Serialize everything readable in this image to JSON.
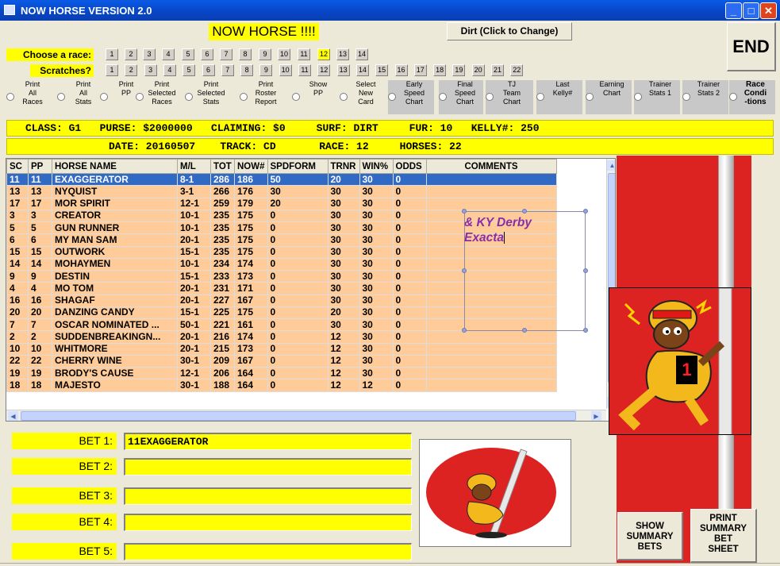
{
  "window": {
    "title": "NOW HORSE VERSION 2.0"
  },
  "header": {
    "app_label": "NOW HORSE !!!!",
    "surface_button": "Dirt (Click to Change)",
    "end_button": "END"
  },
  "race_selector": {
    "label": "Choose  a race:",
    "races": [
      "1",
      "2",
      "3",
      "4",
      "5",
      "6",
      "7",
      "8",
      "9",
      "10",
      "11",
      "12",
      "13",
      "14"
    ],
    "selected": "12"
  },
  "scratches": {
    "label": "Scratches?",
    "numbers": [
      "1",
      "2",
      "3",
      "4",
      "5",
      "6",
      "7",
      "8",
      "9",
      "10",
      "11",
      "12",
      "13",
      "14",
      "15",
      "16",
      "17",
      "18",
      "19",
      "20",
      "21",
      "22"
    ]
  },
  "options": [
    {
      "label": "Print\nAll\nRaces"
    },
    {
      "label": "Print\nAll\nStats"
    },
    {
      "label": "Print\nPP"
    },
    {
      "label": "Print\nSelected\nRaces"
    },
    {
      "label": "Print\nSelected\nStats"
    },
    {
      "label": "Print\nRoster\nReport"
    },
    {
      "label": "Show\nPP"
    },
    {
      "label": "Select\nNew\nCard"
    },
    {
      "label": "Early\nSpeed\nChart"
    },
    {
      "label": "Final\nSpeed\nChart"
    },
    {
      "label": "TJ\nTeam\nChart"
    },
    {
      "label": "Last\nKelly#"
    },
    {
      "label": "Earning\nChart"
    },
    {
      "label": "Trainer\nStats 1"
    },
    {
      "label": "Trainer\nStats 2"
    },
    {
      "label": "Race\nCondi\n-tions"
    }
  ],
  "info": {
    "line1": "CLASS: G1   PURSE: $2000000   CLAIMING: $0     SURF: DIRT     FUR: 10   KELLY#: 250",
    "line2": "DATE: 20160507    TRACK: CD       RACE: 12     HORSES: 22"
  },
  "table": {
    "columns": [
      "SC",
      "PP",
      "HORSE NAME",
      "M/L",
      "TOT",
      "NOW#",
      "SPDFORM",
      "TRNR",
      "WIN%",
      "ODDS",
      "COMMENTS"
    ],
    "rows": [
      [
        "11",
        "11",
        "EXAGGERATOR",
        "8-1",
        "286",
        "186",
        "50",
        "20",
        "30",
        "0",
        ""
      ],
      [
        "13",
        "13",
        "NYQUIST",
        "3-1",
        "266",
        "176",
        "30",
        "30",
        "30",
        "0",
        ""
      ],
      [
        "17",
        "17",
        "MOR SPIRIT",
        "12-1",
        "259",
        "179",
        "20",
        "30",
        "30",
        "0",
        ""
      ],
      [
        "3",
        "3",
        "CREATOR",
        "10-1",
        "235",
        "175",
        "0",
        "30",
        "30",
        "0",
        ""
      ],
      [
        "5",
        "5",
        "GUN RUNNER",
        "10-1",
        "235",
        "175",
        "0",
        "30",
        "30",
        "0",
        ""
      ],
      [
        "6",
        "6",
        "MY MAN SAM",
        "20-1",
        "235",
        "175",
        "0",
        "30",
        "30",
        "0",
        ""
      ],
      [
        "15",
        "15",
        "OUTWORK",
        "15-1",
        "235",
        "175",
        "0",
        "30",
        "30",
        "0",
        ""
      ],
      [
        "14",
        "14",
        "MOHAYMEN",
        "10-1",
        "234",
        "174",
        "0",
        "30",
        "30",
        "0",
        ""
      ],
      [
        "9",
        "9",
        "DESTIN",
        "15-1",
        "233",
        "173",
        "0",
        "30",
        "30",
        "0",
        ""
      ],
      [
        "4",
        "4",
        "MO TOM",
        "20-1",
        "231",
        "171",
        "0",
        "30",
        "30",
        "0",
        ""
      ],
      [
        "16",
        "16",
        "SHAGAF",
        "20-1",
        "227",
        "167",
        "0",
        "30",
        "30",
        "0",
        ""
      ],
      [
        "20",
        "20",
        "DANZING CANDY",
        "15-1",
        "225",
        "175",
        "0",
        "20",
        "30",
        "0",
        ""
      ],
      [
        "7",
        "7",
        "OSCAR NOMINATED ...",
        "50-1",
        "221",
        "161",
        "0",
        "30",
        "30",
        "0",
        ""
      ],
      [
        "2",
        "2",
        "SUDDENBREAKINGN...",
        "20-1",
        "216",
        "174",
        "0",
        "12",
        "30",
        "0",
        ""
      ],
      [
        "10",
        "10",
        "WHITMORE",
        "20-1",
        "215",
        "173",
        "0",
        "12",
        "30",
        "0",
        ""
      ],
      [
        "22",
        "22",
        "CHERRY WINE",
        "30-1",
        "209",
        "167",
        "0",
        "12",
        "30",
        "0",
        ""
      ],
      [
        "19",
        "19",
        "BRODY'S CAUSE",
        "12-1",
        "206",
        "164",
        "0",
        "12",
        "30",
        "0",
        ""
      ],
      [
        "18",
        "18",
        "MAJESTO",
        "30-1",
        "188",
        "164",
        "0",
        "12",
        "12",
        "0",
        ""
      ]
    ]
  },
  "comment_overlay": {
    "line1": "& KY Derby",
    "line2": "Exacta"
  },
  "mascot": {
    "number": "1"
  },
  "bets": [
    {
      "label": "BET 1:",
      "value": "11EXAGGERATOR"
    },
    {
      "label": "BET 2:",
      "value": ""
    },
    {
      "label": "BET 3:",
      "value": ""
    },
    {
      "label": "BET 4:",
      "value": ""
    },
    {
      "label": "BET 5:",
      "value": ""
    }
  ],
  "buttons": {
    "show_summary": "SHOW\nSUMMARY\nBETS",
    "print_summary": "PRINT\nSUMMARY\nBET\nSHEET"
  },
  "colors": {
    "highlight": "#ffff00",
    "row_fill": "#ffcc99",
    "selected_row": "#316ac5",
    "panel_red": "#dd2222",
    "comment_text": "#8a2ea8"
  }
}
